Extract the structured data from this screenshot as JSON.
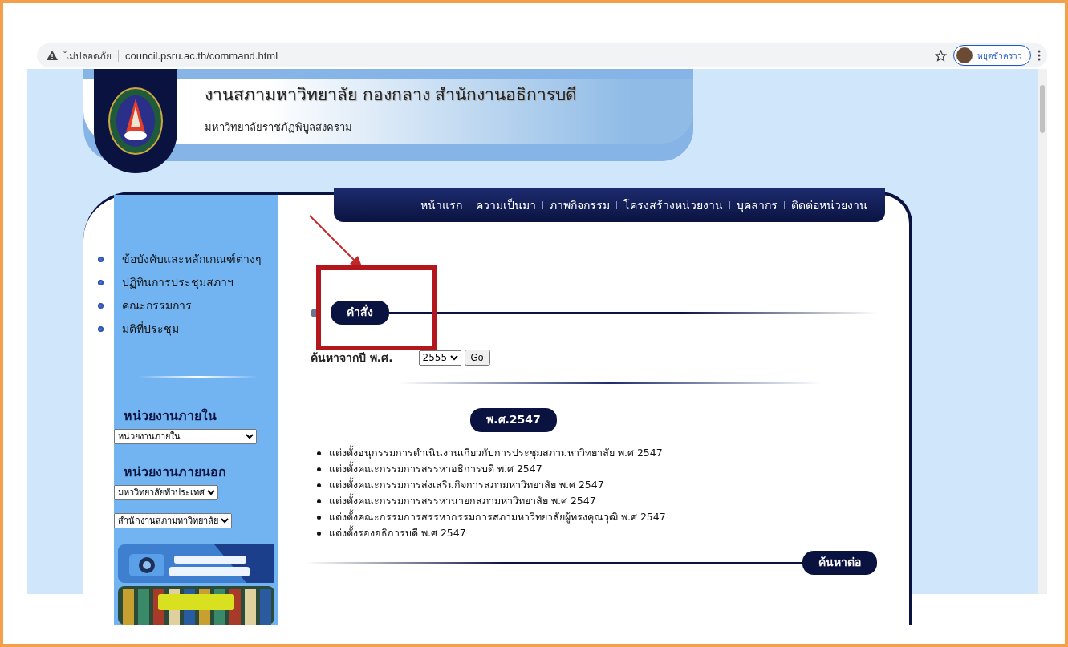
{
  "browser": {
    "warning": "ไม่ปลอดภัย",
    "url": "council.psru.ac.th/command.html",
    "profile": "หยุดชั่วคราว"
  },
  "header": {
    "title": "งานสภามหาวิทยาลัย กองกลาง สำนักงานอธิการบดี",
    "subtitle": "มหาวิทยาลัยราชภัฏพิบูลสงคราม"
  },
  "nav": [
    "หน้าแรก",
    "ความเป็นมา",
    "ภาพกิจกรรม",
    "โครงสร้างหน่วยงาน",
    "บุคลากร",
    "ติดต่อหน่วยงาน"
  ],
  "sidebar": {
    "links": [
      "ข้อบังคับและหลักเกณฑ์ต่างๆ",
      "ปฏิทินการประชุมสภาฯ",
      "คณะกรรมการ",
      "มติที่ประชุม"
    ],
    "internal": {
      "heading": "หน่วยงานภายใน",
      "selects": [
        "หน่วยงานภายใน"
      ]
    },
    "external": {
      "heading": "หน่วยงานภายนอก",
      "selects": [
        "มหาวิทยาลัยทั่วประเทศ",
        "สำนักงานสภามหาวิทยาลัย"
      ]
    }
  },
  "content": {
    "section_title": "คำสั่ง",
    "search": {
      "label": "ค้นหาจากปี พ.ศ.",
      "year": "2555",
      "button": "Go"
    },
    "year_heading": "พ.ศ.2547",
    "items": [
      "แต่งตั้งอนุกรรมการดำเนินงานเกี่ยวกับการประชุมสภามหาวิทยาลัย พ.ศ 2547",
      "แต่งตั้งคณะกรรมการสรรหาอธิการบดี พ.ศ 2547",
      "แต่งตั้งคณะกรรมการส่งเสริมกิจการสภามหาวิทยาลัย พ.ศ 2547",
      "แต่งตั้งคณะกรรมการสรรหานายกสภามหาวิทยาลัย พ.ศ 2547",
      "แต่งตั้งคณะกรรมการสรรหากรรมการสภามหาวิทยาลัยผู้ทรงคุณวุฒิ พ.ศ 2547",
      "แต่งตั้งรองอธิการบดี พ.ศ 2547"
    ],
    "more": "ค้นหาต่อ"
  }
}
